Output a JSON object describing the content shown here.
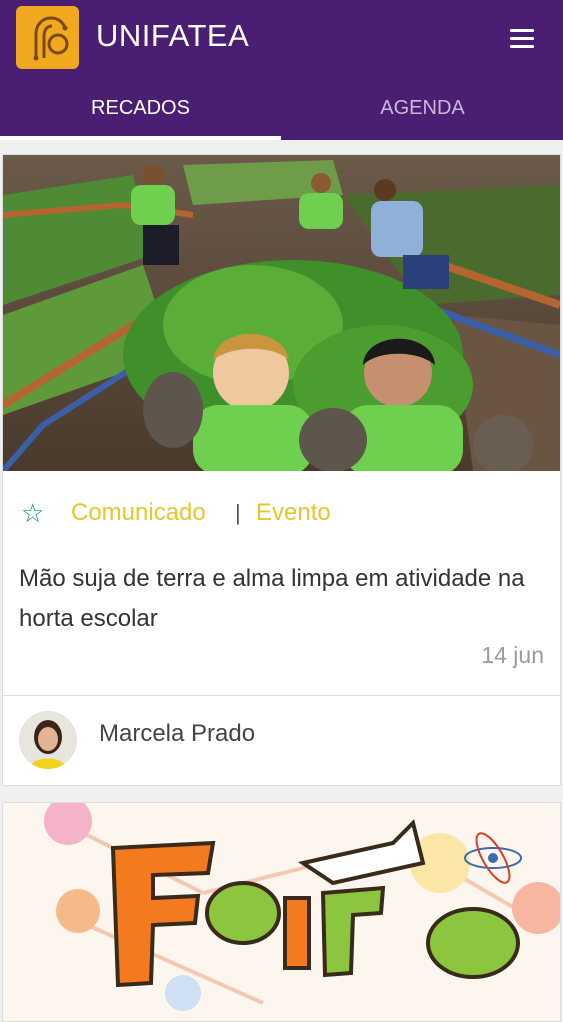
{
  "app": {
    "title": "UNIFATEA",
    "brand_color": "#4a1f73",
    "logo_color": "#f0a81f",
    "menu_icon": "hamburger-menu-icon"
  },
  "tabs": [
    {
      "label": "RECADOS",
      "active": true
    },
    {
      "label": "AGENDA",
      "active": false
    }
  ],
  "posts": [
    {
      "image": "children-in-school-garden-photo",
      "favorite_icon": "star-outline-icon",
      "categories": [
        "Comunicado",
        "Evento"
      ],
      "separator": "|",
      "title": "Mão suja de terra e alma limpa em atividade na horta escolar",
      "date": "14 jun",
      "author": "Marcela Prado",
      "category_color": "#e5c62b"
    },
    {
      "image": "feira-de-ciencias-poster"
    }
  ]
}
